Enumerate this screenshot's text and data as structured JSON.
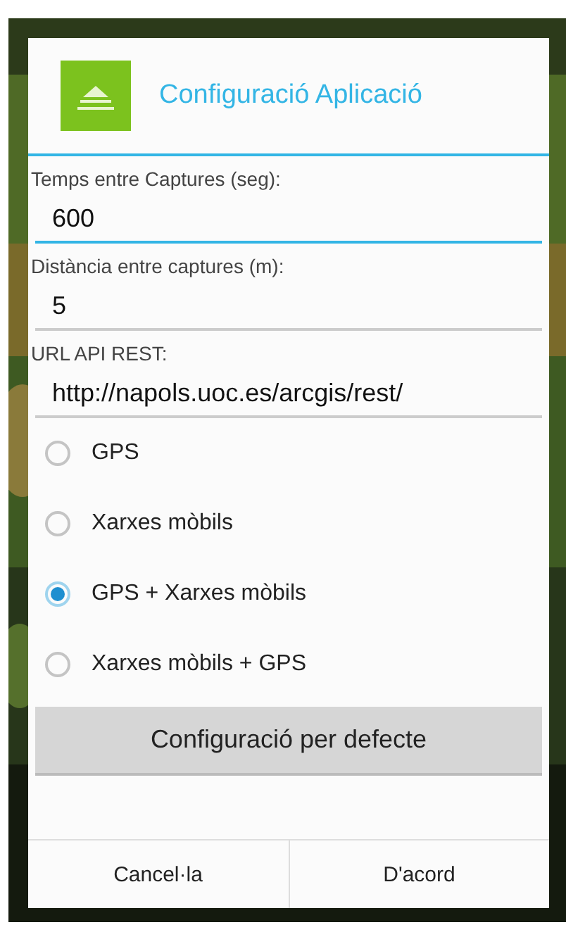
{
  "dialog": {
    "title": "Configuració Aplicació"
  },
  "fields": [
    {
      "label": "Temps entre Captures (seg):",
      "value": "600",
      "focused": true
    },
    {
      "label": "Distància entre captures (m):",
      "value": "5",
      "focused": false
    },
    {
      "label": "URL API REST:",
      "value": "http://napols.uoc.es/arcgis/rest/",
      "focused": false
    }
  ],
  "location_options": [
    {
      "label": "GPS",
      "selected": false
    },
    {
      "label": "Xarxes mòbils",
      "selected": false
    },
    {
      "label": "GPS + Xarxes mòbils",
      "selected": true
    },
    {
      "label": "Xarxes mòbils + GPS",
      "selected": false
    }
  ],
  "default_button": "Configuració per defecte",
  "buttons": [
    "Cancel·la",
    "D'acord"
  ]
}
